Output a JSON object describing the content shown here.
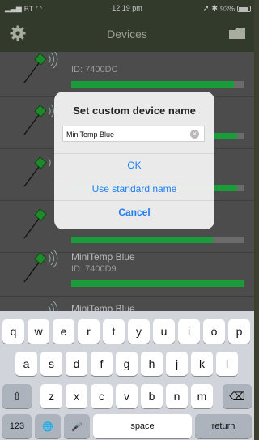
{
  "status_bar": {
    "carrier": "BT",
    "time": "12:19 pm",
    "battery_text": "93%",
    "battery_level": 0.93
  },
  "nav": {
    "title": "Devices",
    "left_icon": "gear-icon",
    "right_icon": "folder-icon"
  },
  "devices": [
    {
      "name": "",
      "id_label": "ID:",
      "id": "7400DC",
      "signal": 0.94
    },
    {
      "name": "",
      "id_label": "",
      "id": "",
      "signal": 0.96
    },
    {
      "name": "",
      "id_label": "",
      "id": "",
      "signal": 0.96
    },
    {
      "name": "",
      "id_label": "",
      "id": "",
      "signal": 0.82
    },
    {
      "name": "MiniTemp Blue",
      "id_label": "ID:",
      "id": "7400D9",
      "signal": 1.0
    },
    {
      "name": "MiniTemp Blue",
      "id_label": "",
      "id": "",
      "signal": 0
    }
  ],
  "dialog": {
    "title": "Set custom device name",
    "input_value": "MiniTemp Blue",
    "ok": "OK",
    "use_standard": "Use standard name",
    "cancel": "Cancel"
  },
  "keyboard": {
    "row1": [
      "q",
      "w",
      "e",
      "r",
      "t",
      "y",
      "u",
      "i",
      "o",
      "p"
    ],
    "row2": [
      "a",
      "s",
      "d",
      "f",
      "g",
      "h",
      "j",
      "k",
      "l"
    ],
    "row3": [
      "z",
      "x",
      "c",
      "v",
      "b",
      "n",
      "m"
    ],
    "numbers_key": "123",
    "space": "space",
    "return": "return",
    "shift_glyph": "⇧",
    "delete_glyph": "⌫",
    "globe_glyph": "🌐",
    "mic_glyph": "🎤"
  },
  "colors": {
    "signal_green": "#1a9c3b",
    "accent_blue": "#1f7cf2"
  }
}
